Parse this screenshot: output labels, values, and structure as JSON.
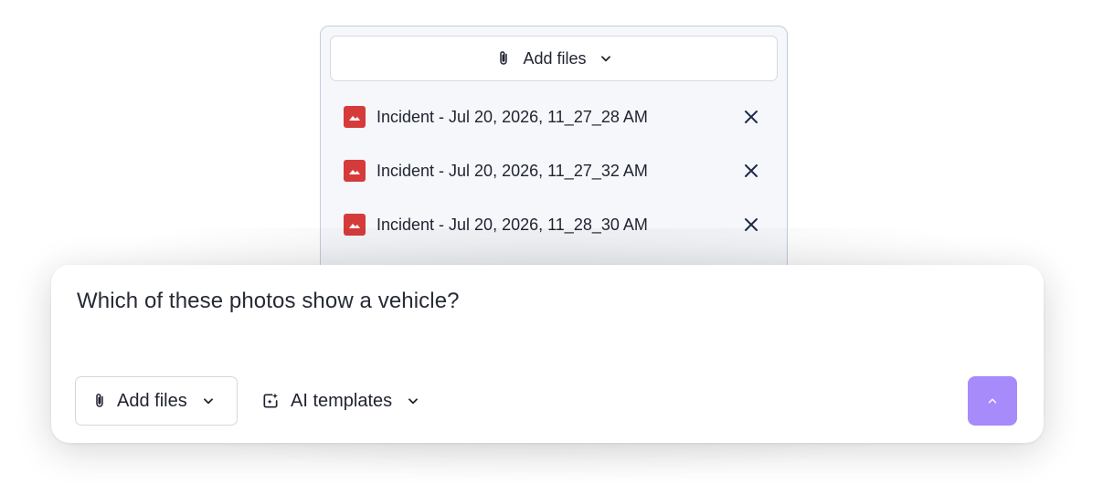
{
  "attachments_panel": {
    "add_files_label": "Add files",
    "files": [
      {
        "name": "Incident - Jul 20, 2026, 11_27_28 AM",
        "icon": "image-icon"
      },
      {
        "name": "Incident - Jul 20, 2026, 11_27_32 AM",
        "icon": "image-icon"
      },
      {
        "name": "Incident - Jul 20, 2026, 11_28_30 AM",
        "icon": "image-icon"
      }
    ]
  },
  "composer": {
    "prompt_text": "Which of these photos show a vehicle?",
    "add_files_label": "Add files",
    "templates_label": "AI templates",
    "send_icon": "chevron-up-icon"
  },
  "colors": {
    "send_button": "#a78bfa",
    "file_icon": "#d63b3b"
  }
}
